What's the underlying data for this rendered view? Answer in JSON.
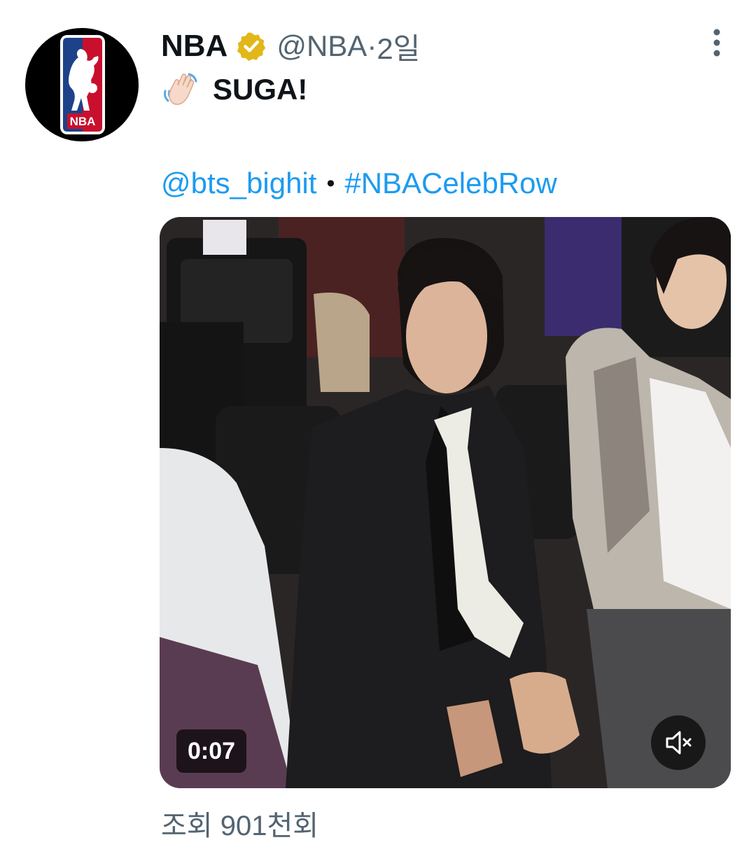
{
  "tweet": {
    "author_name": "NBA",
    "handle": "@NBA",
    "separator": "·",
    "time_ago": "2일",
    "text": "SUGA!",
    "mention": "@bts_bighit",
    "bullet": "•",
    "hashtag": "#NBACelebRow",
    "avatar_icon": "nba-logo-icon",
    "emoji_icon": "waving-hand-icon"
  },
  "media": {
    "type": "video",
    "duration": "0:07",
    "mute_icon": "volume-muted-icon"
  },
  "stats": {
    "views": "조회 901천회"
  },
  "colors": {
    "link": "#1d9bf0",
    "verified": "#e2b719",
    "secondary_text": "#536471",
    "primary_text": "#0f1419"
  }
}
